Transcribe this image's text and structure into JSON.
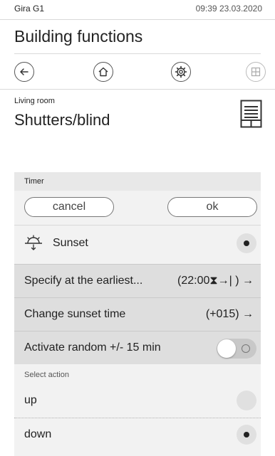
{
  "status_bar": {
    "device": "Gira G1",
    "clock": "09:39 23.03.2020"
  },
  "page": {
    "title": "Building functions"
  },
  "nav": {
    "icons": [
      "back-arrow-icon",
      "home-icon",
      "gear-icon",
      "grid-icon"
    ]
  },
  "function": {
    "room": "Living room",
    "title": "Shutters/blind",
    "icon": "blind-icon"
  },
  "timer": {
    "header": "Timer",
    "cancel_label": "cancel",
    "ok_label": "ok",
    "sunset_label": "Sunset",
    "sunset_selected": true,
    "earliest_label": "Specify at the earliest...",
    "earliest_value": "(22:00⧗→| ) →",
    "change_label": "Change sunset time",
    "change_value": "(+015) →",
    "random_label": "Activate random +/- 15 min",
    "random_enabled": false
  },
  "action": {
    "header": "Select action",
    "options": [
      {
        "label": "up",
        "selected": false
      },
      {
        "label": "down",
        "selected": true
      }
    ]
  },
  "colors": {
    "panel_bg": "#f2f2f2",
    "row_bg": "#dedede",
    "text": "#222222"
  }
}
